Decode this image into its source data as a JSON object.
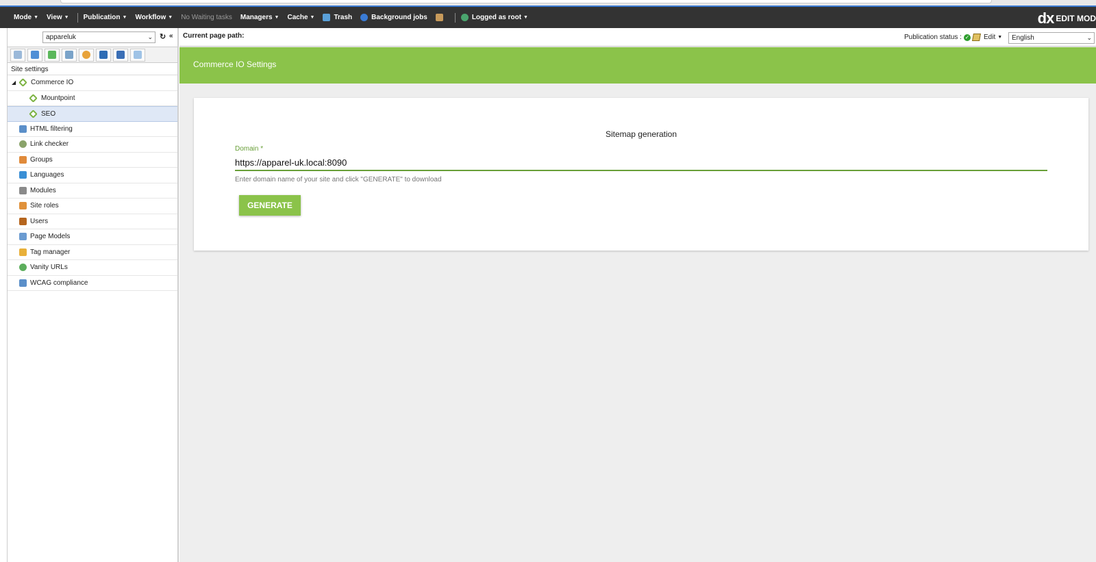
{
  "topbar": {
    "items": [
      {
        "label": "Mode",
        "caret": true
      },
      {
        "label": "View",
        "caret": true
      },
      {
        "label": "Publication",
        "caret": true
      },
      {
        "label": "Workflow",
        "caret": true
      },
      {
        "label": "No Waiting tasks",
        "caret": false
      },
      {
        "label": "Managers",
        "caret": true
      },
      {
        "label": "Cache",
        "caret": true
      },
      {
        "label": "Trash",
        "caret": false
      },
      {
        "label": "Background jobs",
        "caret": false
      },
      {
        "label": "Logged as root",
        "caret": true
      }
    ],
    "brand_logo": "dx",
    "brand_mode": "EDIT MOD"
  },
  "sidebar": {
    "site_select": "appareluk",
    "section_label": "Site settings",
    "tree": [
      {
        "label": "Commerce IO",
        "icon": "commerce-io-icon"
      },
      {
        "label": "Mountpoint",
        "icon": "mountpoint-icon"
      },
      {
        "label": "SEO",
        "icon": "seo-icon"
      },
      {
        "label": "HTML filtering",
        "icon": "html-filtering-icon"
      },
      {
        "label": "Link checker",
        "icon": "link-checker-icon"
      },
      {
        "label": "Groups",
        "icon": "groups-icon"
      },
      {
        "label": "Languages",
        "icon": "languages-icon"
      },
      {
        "label": "Modules",
        "icon": "modules-icon"
      },
      {
        "label": "Site roles",
        "icon": "site-roles-icon"
      },
      {
        "label": "Users",
        "icon": "users-icon"
      },
      {
        "label": "Page Models",
        "icon": "page-models-icon"
      },
      {
        "label": "Tag manager",
        "icon": "tag-manager-icon"
      },
      {
        "label": "Vanity URLs",
        "icon": "vanity-urls-icon"
      },
      {
        "label": "WCAG compliance",
        "icon": "wcag-compliance-icon"
      }
    ]
  },
  "pathbar": {
    "current_path_label": "Current page path:",
    "publication_status_label": "Publication status :",
    "edit_label": "Edit",
    "language": "English"
  },
  "panel": {
    "title": "Commerce IO Settings",
    "card_title": "Sitemap generation",
    "domain_label": "Domain *",
    "domain_value": "https://apparel-uk.local:8090",
    "helper_text": "Enter domain name of your site and click \"GENERATE\" to download",
    "generate_label": "GENERATE"
  },
  "colors": {
    "accent_green": "#8bc34a",
    "topbar_bg": "#333333",
    "selected_row": "#dfe8f6"
  }
}
